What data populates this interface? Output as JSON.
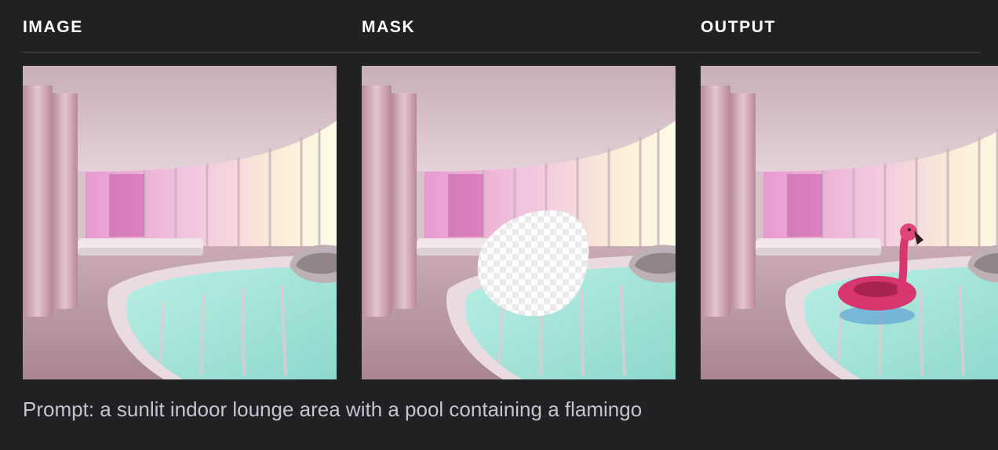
{
  "headers": {
    "image": "IMAGE",
    "mask": "MASK",
    "output": "OUTPUT"
  },
  "prompt": "Prompt: a sunlit indoor lounge area with a pool containing a flamingo",
  "colors": {
    "background": "#202123",
    "header_text": "#ffffff",
    "prompt_text": "#c5c5d2",
    "pool_water": "#9fe3d6",
    "flamingo": "#d8366e"
  }
}
